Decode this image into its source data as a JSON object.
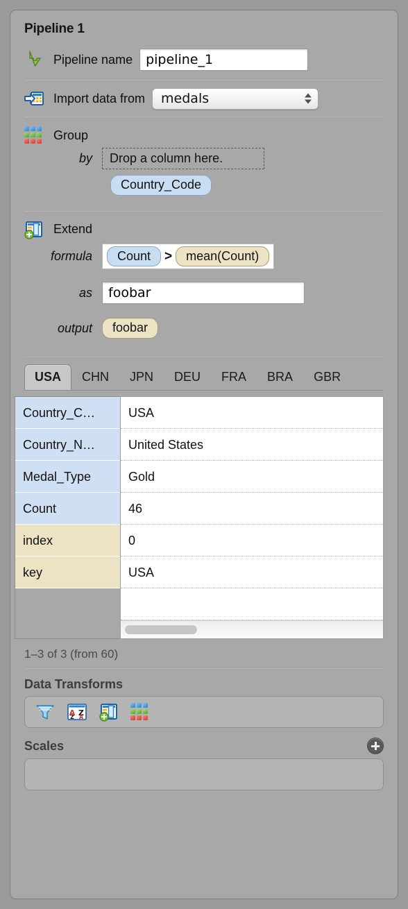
{
  "panel": {
    "title": "Pipeline 1"
  },
  "pipeline_name": {
    "icon": "arrow-down-right-icon",
    "label": "Pipeline name",
    "value": "pipeline_1",
    "placeholder": "pipeline name"
  },
  "import": {
    "icon": "import-table-icon",
    "label": "Import data from",
    "selected": "medals",
    "options": [
      "medals"
    ]
  },
  "group": {
    "icon": "group-grid-icon",
    "label": "Group",
    "by_label": "by",
    "dropzone_text": "Drop a column here.",
    "columns": [
      "Country_Code"
    ]
  },
  "extend": {
    "icon": "extend-table-icon",
    "label": "Extend",
    "formula_label": "formula",
    "formula": {
      "left": "Count",
      "operator": ">",
      "right": "mean(Count)"
    },
    "as_label": "as",
    "as_value": "foobar",
    "output_label": "output",
    "output_pill": "foobar"
  },
  "tabs": {
    "items": [
      "USA",
      "CHN",
      "JPN",
      "DEU",
      "FRA",
      "BRA",
      "GBR"
    ],
    "active": "USA"
  },
  "record_table": {
    "rows": [
      {
        "key": "Country_C…",
        "value": "USA",
        "kind": "blue"
      },
      {
        "key": "Country_N…",
        "value": "United States",
        "kind": "blue"
      },
      {
        "key": "Medal_Type",
        "value": "Gold",
        "kind": "blue"
      },
      {
        "key": "Count",
        "value": "46",
        "kind": "blue"
      },
      {
        "key": "index",
        "value": "0",
        "kind": "tan"
      },
      {
        "key": "key",
        "value": "USA",
        "kind": "tan"
      }
    ]
  },
  "status": "1–3 of 3 (from 60)",
  "data_transforms": {
    "title": "Data Transforms",
    "icons": [
      "filter-funnel-icon",
      "sort-az-icon",
      "extend-table-icon",
      "group-grid-icon"
    ]
  },
  "scales": {
    "title": "Scales",
    "add_icon": "plus-circle-icon",
    "items": []
  },
  "colors": {
    "panel_bg": "#a8a8a8",
    "window_bg": "#9a9a9a",
    "pill_blue": "#c8dcf2",
    "pill_tan": "#ece3c4",
    "key_blue": "#cfe0f5",
    "key_tan": "#ece3c4",
    "tab_active_bg": "#c7c7c7"
  }
}
